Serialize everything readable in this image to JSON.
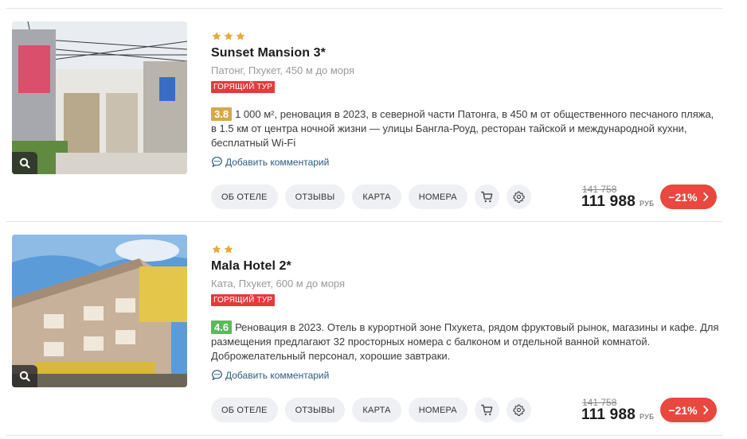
{
  "hotels": [
    {
      "stars": 3,
      "name": "Sunset Mansion 3*",
      "location": "Патонг, Пхукет, 450 м до моря",
      "badge": "ГОРЯЩИЙ ТУР",
      "rating": "3.8",
      "rating_color": "#d6a84a",
      "description": "1 000 м², реновация в 2023, в северной части Патонга, в 450 м от общественного песчаного пляжа, в 1.5 км от центра ночной жизни — улицы Бангла-Роуд, ресторан тайской и международной кухни, бесплатный Wi-Fi",
      "comment_link": "Добавить комментарий",
      "buttons": {
        "about": "ОБ ОТЕЛЕ",
        "reviews": "ОТЗЫВЫ",
        "map": "КАРТА",
        "rooms": "НОМЕРА"
      },
      "old_price": "141 758",
      "price": "111 988",
      "currency": "РУБ",
      "discount": "−21%"
    },
    {
      "stars": 2,
      "name": "Mala Hotel 2*",
      "location": "Ката, Пхукет, 600 м до моря",
      "badge": "ГОРЯЩИЙ ТУР",
      "rating": "4.6",
      "rating_color": "#5cb85c",
      "description": "Реновация в 2023. Отель в курортной зоне Пхукета, рядом фруктовый рынок, магазины и кафе. Для размещения предлагают 32 просторных номера с балконом и отдельной ванной комнатой. Доброжелательный персонал, хорошие завтраки.",
      "comment_link": "Добавить комментарий",
      "buttons": {
        "about": "ОБ ОТЕЛЕ",
        "reviews": "ОТЗЫВЫ",
        "map": "КАРТА",
        "rooms": "НОМЕРА"
      },
      "old_price": "141 758",
      "price": "111 988",
      "currency": "РУБ",
      "discount": "−21%"
    }
  ],
  "icons": {
    "zoom": "magnifier-icon",
    "star": "star-icon",
    "comment": "chat-bubble-icon",
    "cart": "cart-icon",
    "settings": "gear-icon",
    "arrow": "chevron-right-icon"
  }
}
